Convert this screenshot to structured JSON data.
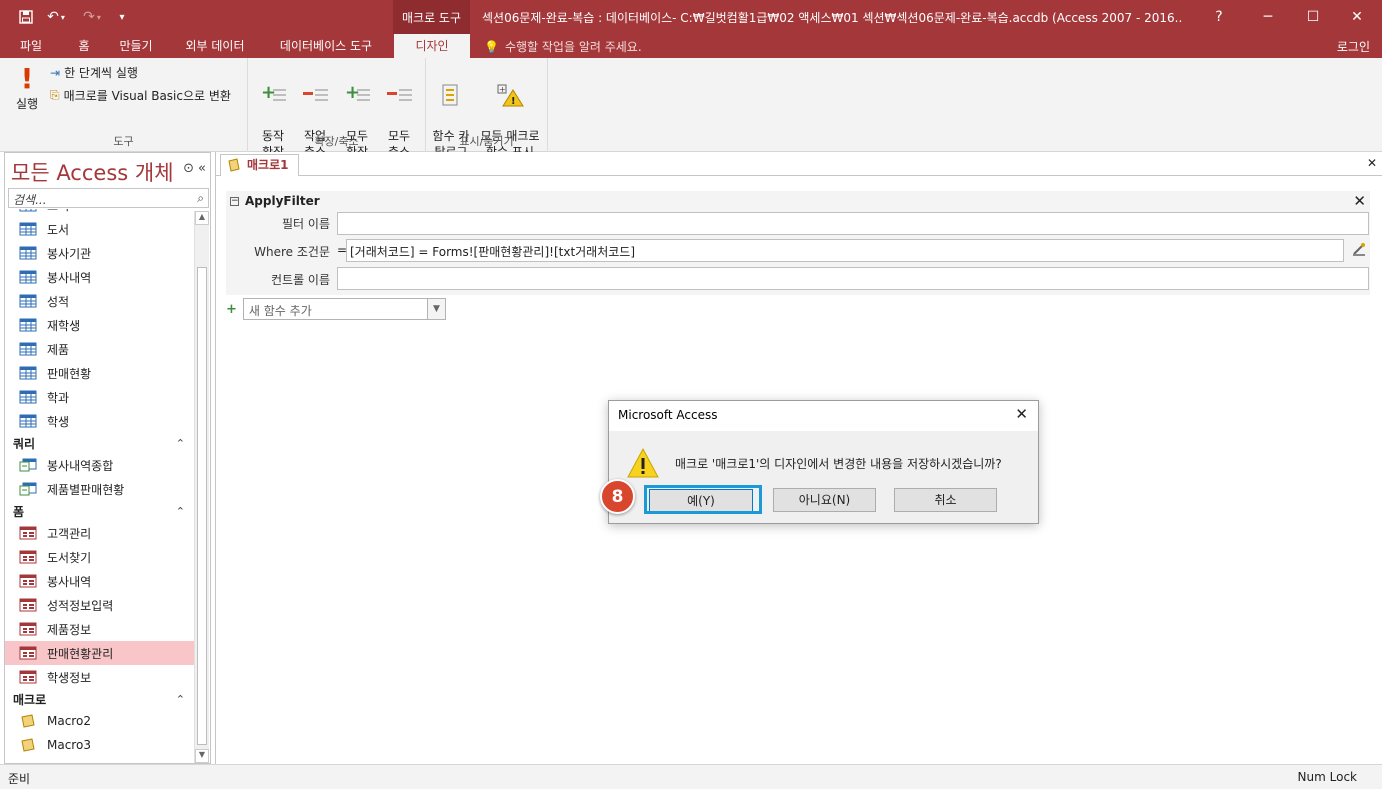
{
  "titlebar": {
    "context_tool": "매크로 도구",
    "title": "섹션06문제-완료-복습 : 데이터베이스- C:₩길벗컴활1급₩02 액세스₩01 섹션₩섹션06문제-완료-복습.accdb (Access 2007 - 2016...",
    "help": "?",
    "minimize": "─",
    "maximize": "☐",
    "close": "✕"
  },
  "tabs": {
    "items": [
      "파일",
      "홈",
      "만들기",
      "외부 데이터",
      "데이터베이스 도구",
      "디자인"
    ],
    "active": "디자인",
    "tell_me": "수행할 작업을 알려 주세요.",
    "sign_in": "로그인"
  },
  "ribbon": {
    "tools": {
      "run_label": "실행",
      "single_step": "한 단계씩 실행",
      "convert": "매크로를 Visual Basic으로 변환",
      "group": "도구"
    },
    "expand": {
      "expand_actions": "동작\n확장",
      "collapse_actions": "작업\n축소",
      "expand_all": "모두\n확장",
      "collapse_all": "모두\n축소",
      "group": "확장/축소"
    },
    "show_hide": {
      "catalog": "함수 카\n탈로그",
      "show_all": "모든 매크로\n함수 표시",
      "group": "표시/숨기기"
    }
  },
  "nav": {
    "title": "모든 Access 개체",
    "search_placeholder": "검색...",
    "tables": [
      "고객",
      "도서",
      "봉사기관",
      "봉사내역",
      "성적",
      "재학생",
      "제품",
      "판매현황",
      "학과",
      "학생"
    ],
    "query_cat": "쿼리",
    "queries": [
      "봉사내역종합",
      "제품별판매현황"
    ],
    "form_cat": "폼",
    "forms": [
      "고객관리",
      "도서찾기",
      "봉사내역",
      "성적정보입력",
      "제품정보",
      "판매현황관리",
      "학생정보"
    ],
    "selected_form": "판매현황관리",
    "macro_cat": "매크로",
    "macros": [
      "Macro2",
      "Macro3"
    ]
  },
  "doc": {
    "tab_label": "매크로1",
    "action_name": "ApplyFilter",
    "args": [
      {
        "label": "필터 이름",
        "value": ""
      },
      {
        "label": "Where 조건문",
        "value": "[거래처코드] = Forms![판매현황관리]![txt거래처코드]"
      },
      {
        "label": "컨트롤 이름",
        "value": ""
      }
    ],
    "where_prefix": "=",
    "add_function": "새 함수 추가"
  },
  "status": {
    "left": "준비",
    "right": "Num Lock"
  },
  "dialog": {
    "title": "Microsoft Access",
    "message": "매크로 '매크로1'의 디자인에서 변경한 내용을 저장하시겠습니까?",
    "yes": "예(Y)",
    "no": "아니요(N)",
    "cancel": "취소",
    "step_marker": "8"
  },
  "colors": {
    "accent": "#a4373a",
    "selected_item": "#f8c6c8",
    "highlight": "#1a9bd7",
    "marker": "#d9462e"
  }
}
